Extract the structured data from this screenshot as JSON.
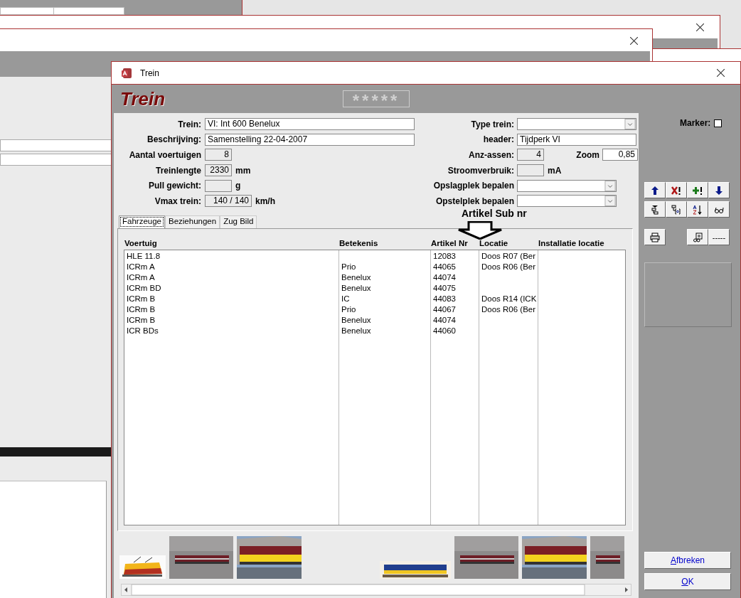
{
  "window": {
    "title": "Trein"
  },
  "header": {
    "title": "Trein",
    "field_value": "*****"
  },
  "form": {
    "left": [
      {
        "label": "Trein:",
        "kind": "text",
        "value": "VI: Int 600 Benelux"
      },
      {
        "label": "Beschrijving:",
        "kind": "text",
        "value": "Samenstelling 22-04-2007"
      },
      {
        "label": "Aantal voertuigen",
        "kind": "number",
        "value": "8"
      },
      {
        "label": "Treinlengte",
        "kind": "number",
        "value": "2330",
        "unit": "mm"
      },
      {
        "label": "Pull gewicht:",
        "kind": "number",
        "unit": "g"
      },
      {
        "label": "Vmax trein:",
        "kind": "number",
        "value": "140 / 140",
        "unit": "km/h"
      }
    ],
    "right": [
      {
        "label": "Type trein:",
        "kind": "combo"
      },
      {
        "label": "header:",
        "kind": "text",
        "value": "Tijdperk VI"
      },
      {
        "label": "Anz-assen:",
        "kind": "number",
        "value": "4",
        "extra": {
          "label": "Zoom",
          "value": "0,85"
        }
      },
      {
        "label": "Stroomverbruik:",
        "kind": "number",
        "unit": "mA"
      },
      {
        "label": "Opslagplek bepalen",
        "kind": "combo"
      },
      {
        "label": "Opstelplek bepalen",
        "kind": "combo"
      }
    ]
  },
  "marker": {
    "label": "Marker:",
    "checked": false
  },
  "annotation": {
    "text": "Artikel Sub nr"
  },
  "tabs": [
    {
      "label": "Fahrzeuge",
      "selected": true
    },
    {
      "label": "Beziehungen",
      "selected": false
    },
    {
      "label": "Zug Bild",
      "selected": false
    }
  ],
  "table": {
    "columns": [
      "Voertuig",
      "Betekenis",
      "Artikel Nr",
      "Locatie",
      "Installatie locatie"
    ],
    "rows": [
      [
        "HLE 11.8",
        "",
        "12083",
        "Doos R07 (Ber",
        ""
      ],
      [
        "ICRm A",
        "Prio",
        "44065",
        "Doos R06 (Ber",
        ""
      ],
      [
        "ICRm A",
        "Benelux",
        "44074",
        "",
        ""
      ],
      [
        "ICRm BD",
        "Benelux",
        "44075",
        "",
        ""
      ],
      [
        "ICRm B",
        "IC",
        "44083",
        "Doos R14 (ICK",
        ""
      ],
      [
        "ICRm B",
        "Prio",
        "44067",
        "Doos R06 (Ber",
        ""
      ],
      [
        "ICRm B",
        "Benelux",
        "44074",
        "",
        ""
      ],
      [
        "ICR BDs",
        "Benelux",
        "44060",
        "",
        ""
      ]
    ]
  },
  "toolbar": {
    "more_label": "-----"
  },
  "buttons": [
    {
      "label": "Afbreken"
    },
    {
      "label": "OK"
    }
  ]
}
